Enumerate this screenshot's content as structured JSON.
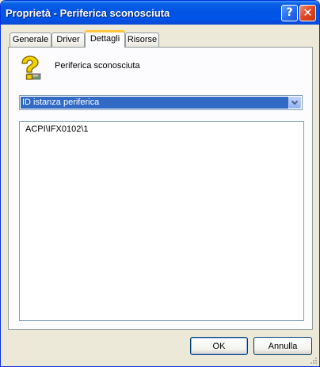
{
  "window": {
    "title": "Proprietà - Periferica sconosciuta",
    "help_glyph": "?",
    "close_glyph": "✕"
  },
  "tabs": [
    {
      "label": "Generale",
      "active": false
    },
    {
      "label": "Driver",
      "active": false
    },
    {
      "label": "Dettagli",
      "active": true
    },
    {
      "label": "Risorse",
      "active": false
    }
  ],
  "details": {
    "device_name": "Periferica sconosciuta",
    "property_selected": "ID istanza periferica",
    "values": [
      "ACPI\\IFX0102\\1"
    ]
  },
  "buttons": {
    "ok": "OK",
    "cancel": "Annulla"
  },
  "colors": {
    "titlebar": "#0054e3",
    "selection": "#316ac5",
    "active_tab_highlight": "#ffc83c",
    "icon_yellow": "#f5d000"
  },
  "icons": {
    "device": "question-mark-device-icon",
    "dropdown": "chevron-down-icon"
  }
}
